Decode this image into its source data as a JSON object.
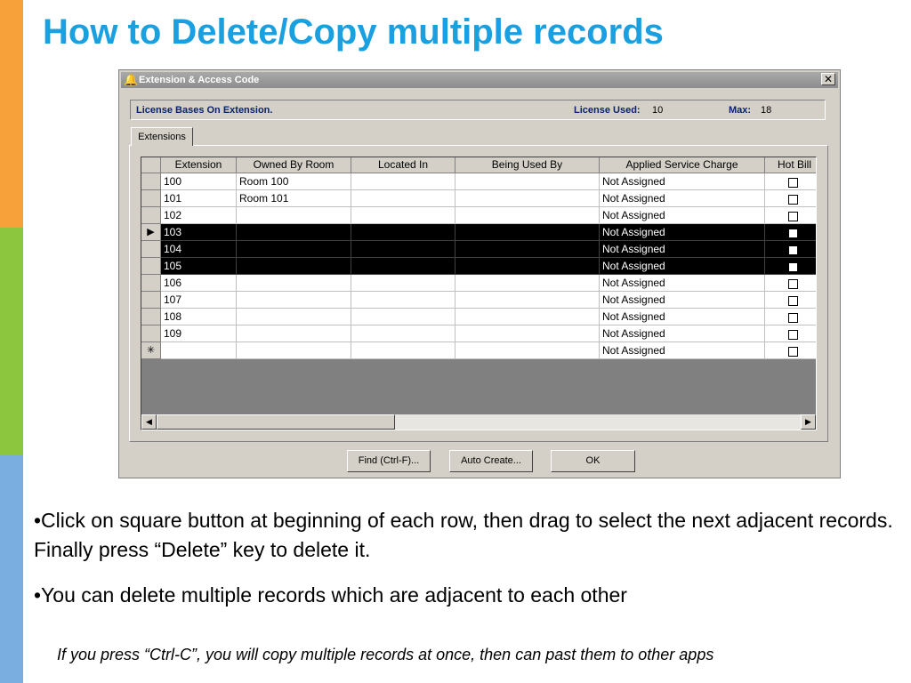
{
  "slide": {
    "title": "How to Delete/Copy multiple records",
    "bullets": [
      "•Click on square button at beginning of each row, then drag to select the next adjacent records. Finally press “Delete” key to delete it.",
      "•You can delete multiple records which are adjacent to each other"
    ],
    "note": "If you press “Ctrl-C”, you will copy multiple records at once, then can past them to other apps",
    "stripe_colors": [
      "#f7a13a",
      "#8cc63f",
      "#7aaee0"
    ],
    "title_color": "#1aa0e0"
  },
  "window": {
    "title": "Extension & Access Code",
    "close_glyph": "✕",
    "icon": "bell-icon"
  },
  "license": {
    "info_label": "License Bases On Extension.",
    "used_label": "License Used:",
    "used_value": "10",
    "max_label": "Max:",
    "max_value": "18"
  },
  "tabs": [
    {
      "label": "Extensions"
    }
  ],
  "grid": {
    "columns": [
      "Extension",
      "Owned By Room",
      "Located In",
      "Being Used By",
      "Applied Service Charge",
      "Hot Bill"
    ],
    "rows": [
      {
        "marker": "",
        "extension": "100",
        "owned_by_room": "Room 100",
        "located_in": "",
        "being_used_by": "",
        "service_charge": "Not Assigned",
        "hot_bill": false,
        "selected": false
      },
      {
        "marker": "",
        "extension": "101",
        "owned_by_room": "Room 101",
        "located_in": "",
        "being_used_by": "",
        "service_charge": "Not Assigned",
        "hot_bill": false,
        "selected": false
      },
      {
        "marker": "",
        "extension": "102",
        "owned_by_room": "",
        "located_in": "",
        "being_used_by": "",
        "service_charge": "Not Assigned",
        "hot_bill": false,
        "selected": false
      },
      {
        "marker": "▶",
        "extension": "103",
        "owned_by_room": "",
        "located_in": "",
        "being_used_by": "",
        "service_charge": "Not Assigned",
        "hot_bill": false,
        "selected": true
      },
      {
        "marker": "",
        "extension": "104",
        "owned_by_room": "",
        "located_in": "",
        "being_used_by": "",
        "service_charge": "Not Assigned",
        "hot_bill": false,
        "selected": true
      },
      {
        "marker": "",
        "extension": "105",
        "owned_by_room": "",
        "located_in": "",
        "being_used_by": "",
        "service_charge": "Not Assigned",
        "hot_bill": false,
        "selected": true
      },
      {
        "marker": "",
        "extension": "106",
        "owned_by_room": "",
        "located_in": "",
        "being_used_by": "",
        "service_charge": "Not Assigned",
        "hot_bill": false,
        "selected": false
      },
      {
        "marker": "",
        "extension": "107",
        "owned_by_room": "",
        "located_in": "",
        "being_used_by": "",
        "service_charge": "Not Assigned",
        "hot_bill": false,
        "selected": false
      },
      {
        "marker": "",
        "extension": "108",
        "owned_by_room": "",
        "located_in": "",
        "being_used_by": "",
        "service_charge": "Not Assigned",
        "hot_bill": false,
        "selected": false
      },
      {
        "marker": "",
        "extension": "109",
        "owned_by_room": "",
        "located_in": "",
        "being_used_by": "",
        "service_charge": "Not Assigned",
        "hot_bill": false,
        "selected": false
      },
      {
        "marker": "✳",
        "extension": "",
        "owned_by_room": "",
        "located_in": "",
        "being_used_by": "",
        "service_charge": "Not Assigned",
        "hot_bill": false,
        "selected": false
      }
    ],
    "scroll_left": "◀",
    "scroll_right": "▶"
  },
  "buttons": {
    "find": "Find (Ctrl-F)...",
    "auto_create": "Auto Create...",
    "ok": "OK"
  }
}
